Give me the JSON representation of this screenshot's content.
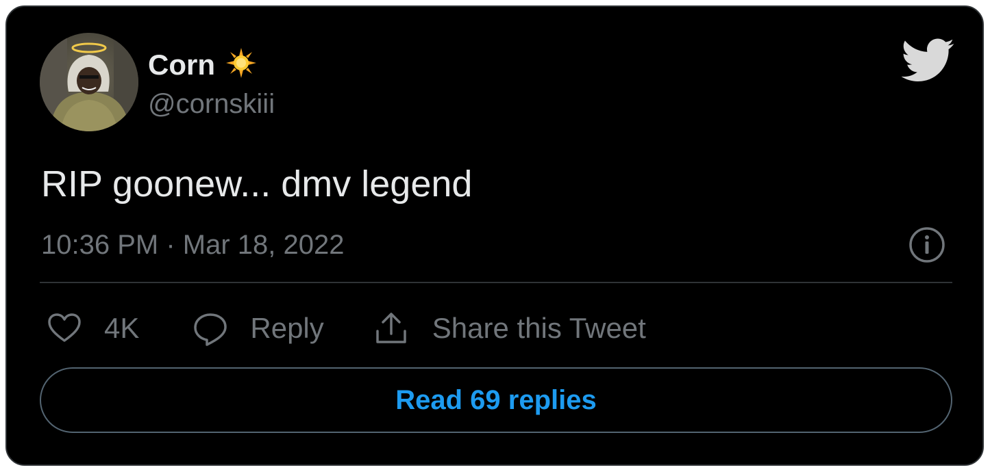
{
  "author": {
    "name": "Corn",
    "handle": "@cornskiii",
    "name_emoji_icon": "sun-emoji-icon",
    "avatar": "profile-photo"
  },
  "tweet": {
    "text": "RIP goonew... dmv legend",
    "timestamp": "10:36 PM · Mar 18, 2022"
  },
  "actions": {
    "like_count": "4K",
    "reply_label": "Reply",
    "share_label": "Share this Tweet"
  },
  "read_replies_label": "Read 69 replies",
  "icons": {
    "brand": "twitter-bird-icon",
    "info": "info-icon",
    "like": "heart-icon",
    "reply": "speech-bubble-icon",
    "share": "share-upload-icon"
  },
  "colors": {
    "background": "#000000",
    "primary_text": "#e7e9ea",
    "secondary_text": "#71767b",
    "accent": "#1d9bf0",
    "border": "#2f3336",
    "bird": "#d9d9d9"
  }
}
